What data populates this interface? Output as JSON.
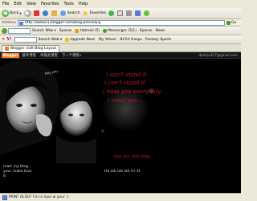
{
  "menubar": {
    "items": [
      "File",
      "Edit",
      "View",
      "Favorites",
      "Tools",
      "Help"
    ]
  },
  "toolbar": {
    "back_label": "Back",
    "search_label": "Search",
    "favorites_label": "Favorites"
  },
  "addressbar": {
    "label": "Address",
    "url": "http://www21.blogger.com/blog-preview.g",
    "go_label": "Go"
  },
  "linksbar": {
    "items": [
      "Search Web",
      "Spaces",
      "Hotmail (5)",
      "Messenger (5/1)",
      "Spaces",
      "News"
    ]
  },
  "yahoobar": {
    "brand": "Y!",
    "search_web_label": "Search Web",
    "upgrade_label": "Upgrade Now!",
    "items": [
      "My Yahoo!",
      "NCAA Hoops",
      "Fantasy Sports"
    ]
  },
  "tab": {
    "title": "Blogger: Edit Blog Layout"
  },
  "blog": {
    "nav_logo": "Blogger",
    "nav_items": [
      "搜寻博客",
      "举报此博客",
      "下一个博客»"
    ],
    "email": "darkly-817@gmail.com",
    "header": {
      "stamp_text": "Hey you",
      "red_lines": [
        "i can't stand it",
        "i can't stand it",
        "i miss you every day",
        "i need you..."
      ],
      "bottom_red": "hey you love blog..."
    },
    "post_left_lines": [
      "mart my blog...",
      "your make love",
      "it"
    ],
    "post_center": "Ha lah lah lah Hi :D"
  },
  "statusbar": {
    "text": "PAIN? ALSO? I'm in love w your :)"
  }
}
